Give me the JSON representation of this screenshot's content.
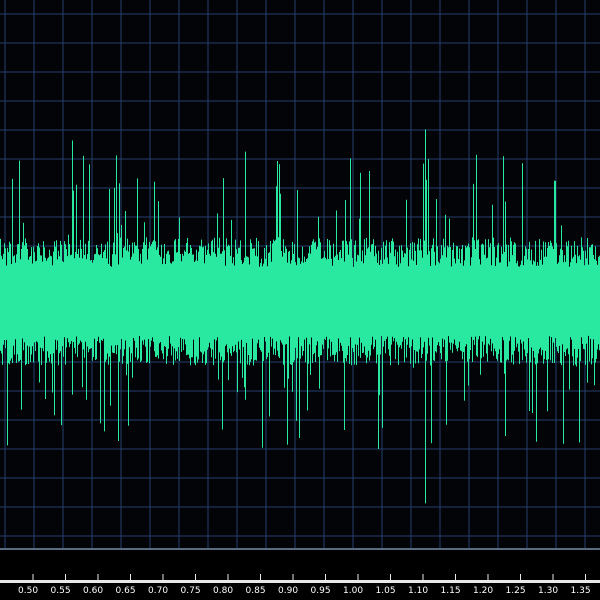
{
  "colors": {
    "background": "#020408",
    "grid": "#24406b",
    "waveform": "#29e8a0",
    "ruler_background": "#000000",
    "ruler_band": "#e8e8e8",
    "ruler_text": "#ffffff"
  },
  "waveform": {
    "center_fraction": 0.55,
    "typical_amplitude_fraction": 0.09,
    "peak_amplitude_fraction": 0.27
  },
  "ruler": {
    "labels": [
      "0.50",
      "0.55",
      "0.60",
      "0.65",
      "0.70",
      "0.75",
      "0.80",
      "0.85",
      "0.90",
      "0.95",
      "1.00",
      "1.05",
      "1.10",
      "1.15",
      "1.20",
      "1.25",
      "1.30",
      "1.35"
    ]
  }
}
